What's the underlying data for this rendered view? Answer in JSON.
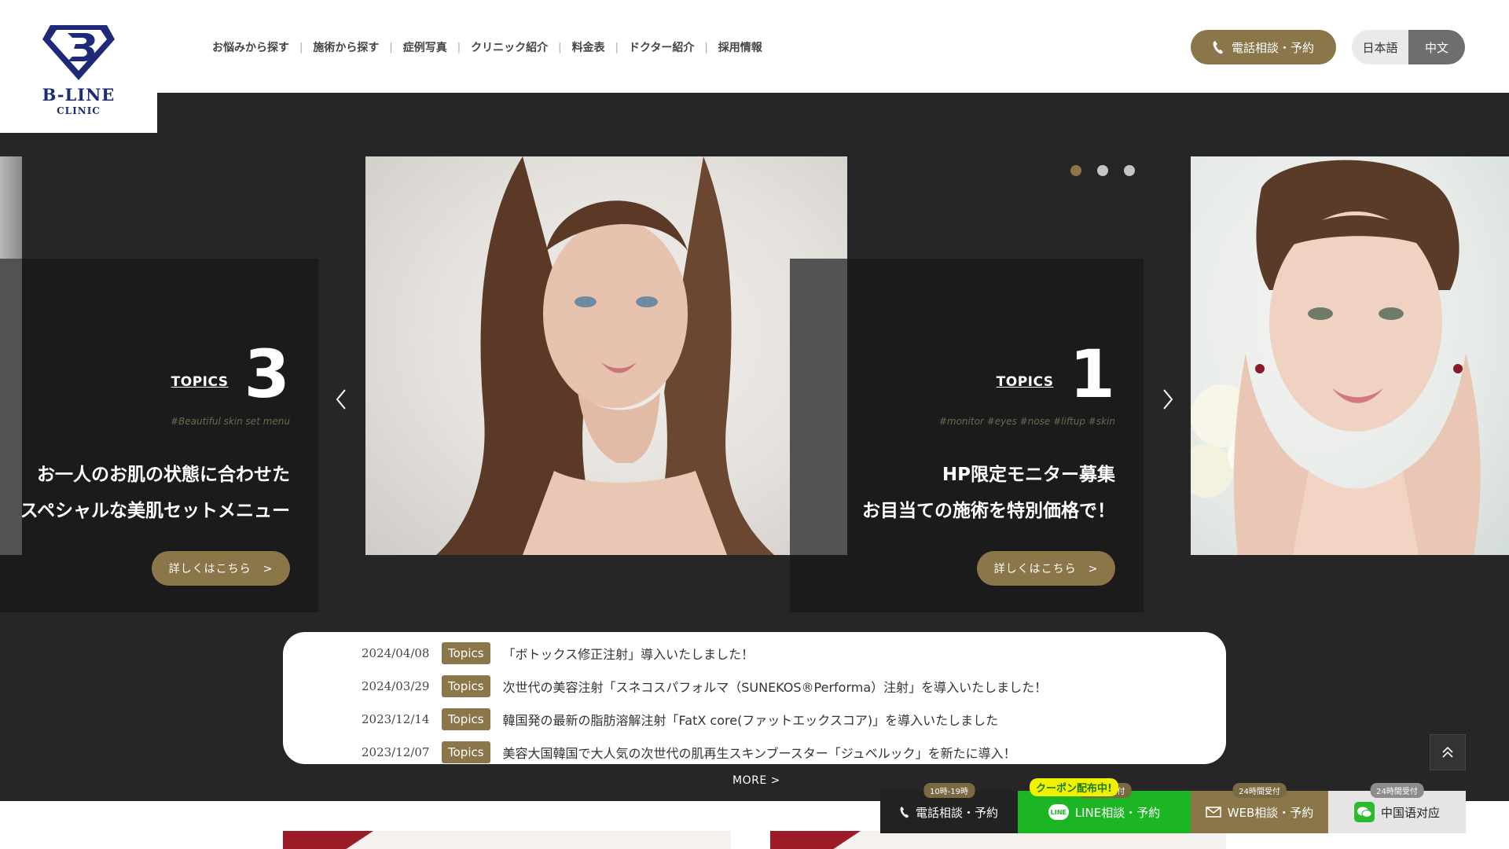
{
  "logo": {
    "name": "B-LINE",
    "sub": "CLINIC"
  },
  "nav": [
    "お悩みから探す",
    "施術から探す",
    "症例写真",
    "クリニック紹介",
    "料金表",
    "ドクター紹介",
    "採用情報"
  ],
  "header": {
    "phone_label": "電話相談・予約",
    "lang_ja": "日本語",
    "lang_zh": "中文"
  },
  "slider": {
    "left": {
      "topics_word": "TOPICS",
      "number": "3",
      "tags": "#Beautiful skin set menu",
      "line1": "お一人のお肌の状態に合わせた",
      "line2": "スペシャルな美肌セットメニュー",
      "button": "詳しくはこちら　>"
    },
    "right": {
      "topics_word": "TOPICS",
      "number": "1",
      "tags": "#monitor #eyes #nose #liftup #skin",
      "line1": "HP限定モニター募集",
      "line2": "お目当ての施術を特別価格で！",
      "button": "詳しくはこちら　>"
    },
    "dots": 3,
    "active_dot": 0
  },
  "news": [
    {
      "date": "2024/04/08",
      "badge": "Topics",
      "title": "「ボトックス修正注射」導入いたしました！"
    },
    {
      "date": "2024/03/29",
      "badge": "Topics",
      "title": "次世代の美容注射「スネコスパフォルマ（SUNEKOS®Performa）注射」を導入いたしました！"
    },
    {
      "date": "2023/12/14",
      "badge": "Topics",
      "title": "韓国発の最新の脂肪溶解注射「FatX core(ファットエックスコア)」を導入いたしました"
    },
    {
      "date": "2023/12/07",
      "badge": "Topics",
      "title": "美容大国韓国で大人気の次世代の肌再生スキンブースター「ジュベルック」を新たに導入！"
    }
  ],
  "more_label": "MORE  >",
  "bottom_bar": {
    "coupon": "クーポン配布中!",
    "phone": {
      "label": "電話相談・予約",
      "tag": "10時-19時"
    },
    "line": {
      "label": "LINE相談・予約",
      "tag": "24時間受付",
      "icon_text": "LINE"
    },
    "web": {
      "label": "WEB相談・予約",
      "tag": "24時間受付"
    },
    "cn": {
      "label": "中国语对应",
      "tag": "24時間受付"
    }
  },
  "colors": {
    "gold": "#8a7649",
    "dark": "#262626",
    "navy": "#1e2a78",
    "line_green": "#1cb523"
  }
}
